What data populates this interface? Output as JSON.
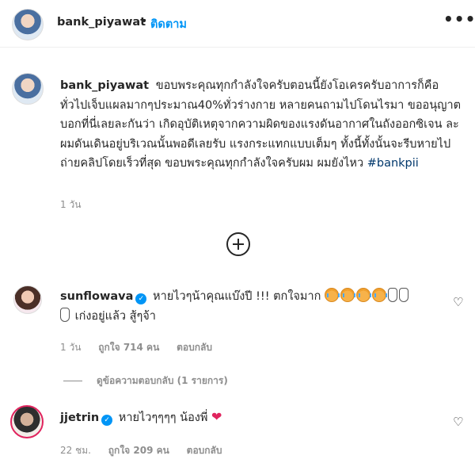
{
  "post": {
    "username": "bank_piyawat",
    "separator": "•",
    "follow_label": "ติดตาม",
    "more_label": "•••"
  },
  "caption": {
    "username": "bank_piyawat",
    "text": "ขอบพระคุณทุกกำลังใจครับตอนนี้ยังโอเครครับอาการก็คือทั่วไปเจ็บแผลมากๆประมาณ40%ทั่วร่างกาย หลายคนถามไปโดนไรมา ขออนุญาตบอกที่นี่เลยละกันว่า เกิดอุบัติเหตุจากความผิดของแรงดันอากาศในถังออกซิเจน ละผมดันเดินอยู่บริเวณนั้นพอดีเลยรับ แรงกระแทกแบบเต็มๆ ทั้งนี้ทั้งนั้นจะรีบหายไปถ่ายคลิปโดยเร็วที่สุด ขอบพระคุณทุกกำลังใจครับผม ผมยังไหว ",
    "hashtag": "#bankpii",
    "time": "1 วัน"
  },
  "comments": [
    {
      "username": "sunflowava",
      "verified_icon": "✓",
      "text_a": "หายไวๆน้าคุณแบ๊งปี !!! ตกใจมาก",
      "text_b": "เก่งอยู่แล้ว สู้ๆจ้า",
      "time": "1 วัน",
      "likes": "ถูกใจ 714 คน",
      "reply": "ตอบกลับ"
    },
    {
      "username": "jjetrin",
      "verified_icon": "✓",
      "text": "หายไวๆๆๆๆ น้องพี่",
      "time": "22 ชม.",
      "likes": "ถูกใจ 209 คน",
      "reply": "ตอบกลับ"
    }
  ],
  "view_replies": "ดูข้อความตอบกลับ (1 รายการ)",
  "icons": {
    "like": "heart-outline-icon",
    "add": "plus-circle-icon"
  }
}
